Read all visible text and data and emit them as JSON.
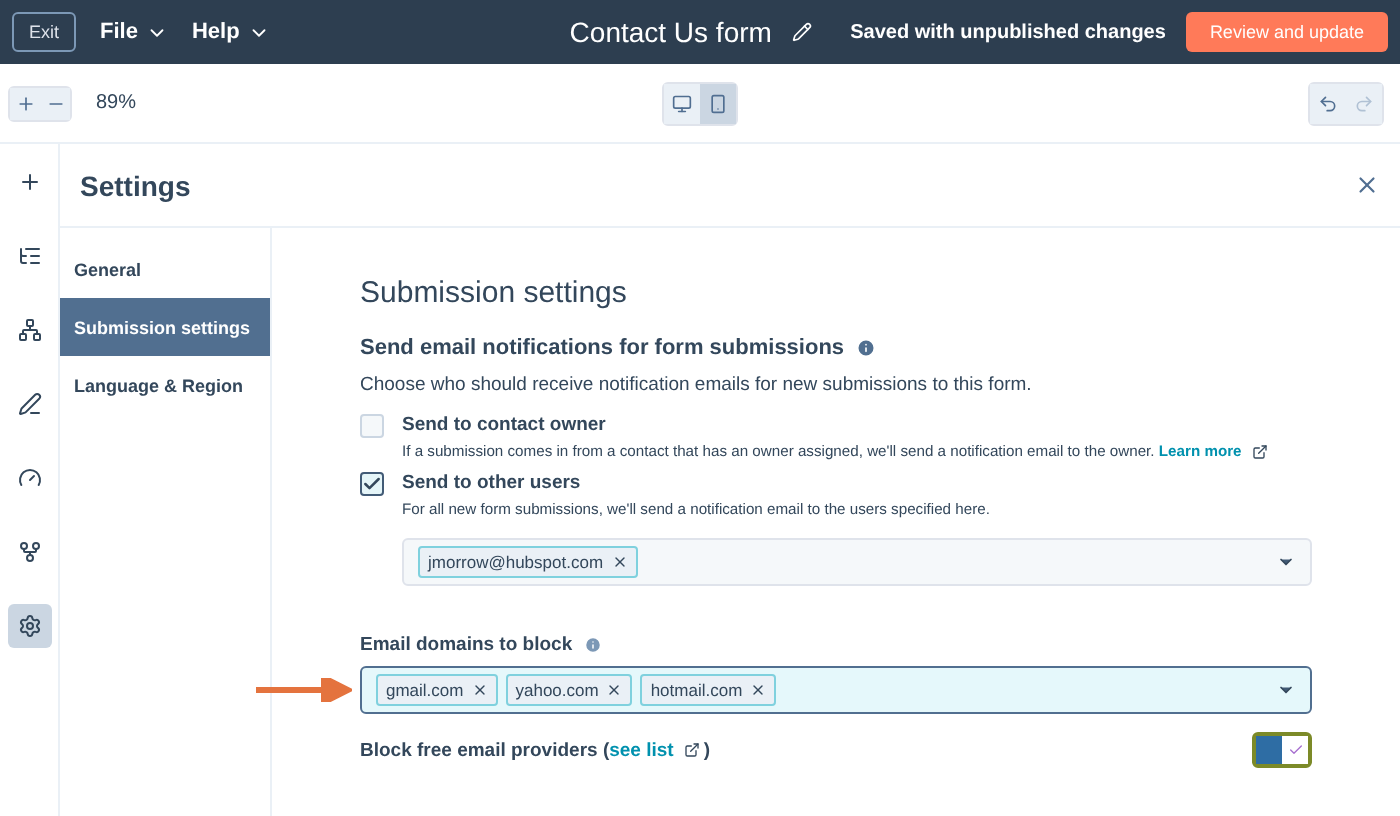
{
  "topbar": {
    "exit": "Exit",
    "menus": [
      "File",
      "Help"
    ],
    "title": "Contact Us form",
    "status": "Saved with unpublished changes",
    "primary": "Review and update"
  },
  "toolbar": {
    "zoom": "89%",
    "devices": [
      {
        "kind": "desktop",
        "selected": false
      },
      {
        "kind": "mobile",
        "selected": true
      }
    ]
  },
  "rail": [
    {
      "kind": "plus",
      "selected": false
    },
    {
      "kind": "tree",
      "selected": false
    },
    {
      "kind": "sitemap",
      "selected": false
    },
    {
      "kind": "pen",
      "selected": false
    },
    {
      "kind": "gauge",
      "selected": false
    },
    {
      "kind": "fork",
      "selected": false
    },
    {
      "kind": "gear",
      "selected": true
    }
  ],
  "settings": {
    "title": "Settings",
    "nav": [
      {
        "label": "General",
        "selected": false
      },
      {
        "label": "Submission settings",
        "selected": true
      },
      {
        "label": "Language & Region",
        "selected": false
      }
    ],
    "heading": "Submission settings",
    "notifications": {
      "title": "Send email notifications for form submissions",
      "description": "Choose who should receive notification emails for new submissions to this form.",
      "options": [
        {
          "label": "Send to contact owner",
          "checked": false,
          "help": "If a submission comes in from a contact that has an owner assigned, we'll send a notification email to the owner.",
          "link": "Learn more"
        },
        {
          "label": "Send to other users",
          "checked": true,
          "help": "For all new form submissions, we'll send a notification email to the users specified here."
        }
      ],
      "recipients": [
        "jmorrow@hubspot.com"
      ]
    },
    "block": {
      "label": "Email domains to block",
      "domains": [
        "gmail.com",
        "yahoo.com",
        "hotmail.com"
      ],
      "focused": true
    },
    "free": {
      "prefix": "Block free email providers (",
      "link": "see list",
      "suffix": ")",
      "on": true
    }
  }
}
